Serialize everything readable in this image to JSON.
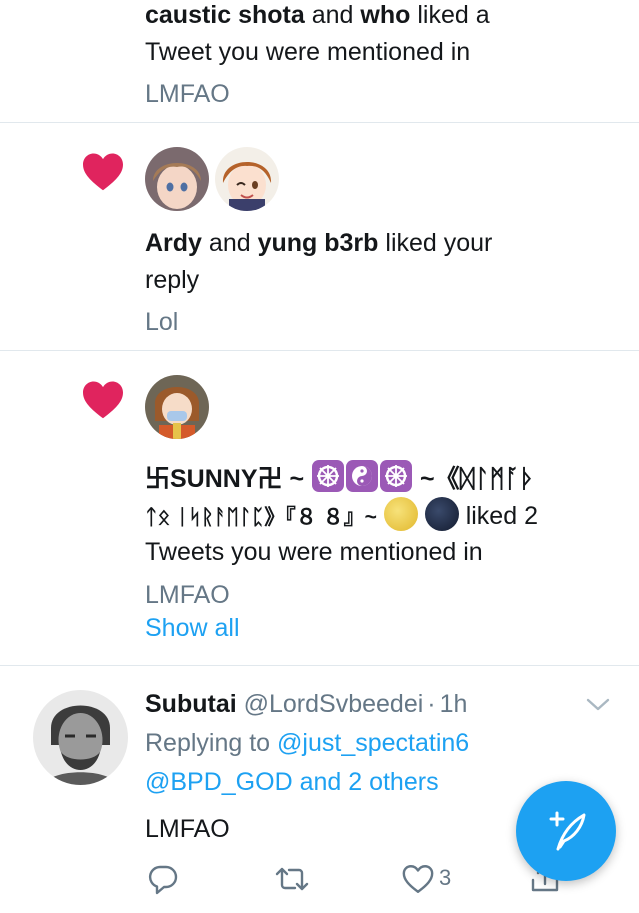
{
  "notif1": {
    "user1": "caustic shota",
    "conj": "and",
    "user2": "who",
    "action_l1": "liked a",
    "action_l2": "Tweet you were mentioned in",
    "snippet": "LMFAO"
  },
  "notif2": {
    "user1": "Ardy",
    "conj": "and",
    "user2": "yung b3rb",
    "action_l1": "liked your",
    "action_l2": "reply",
    "snippet": "Lol"
  },
  "notif3": {
    "name_part1": "卐SUNNY卍 ~",
    "name_part2": "~《ᛞᛚᛗᚪᚦ",
    "name_part3": "ᛏᛟ ᛁᛋᚱᚨᛖᛚᛈ》『８ ８』~",
    "action_l1": "liked 2",
    "action_l2": "Tweets you were mentioned in",
    "snippet": "LMFAO",
    "show_all": "Show all"
  },
  "tweet": {
    "name": "Subutai",
    "handle": "@LordSvbeedei",
    "dot": "·",
    "time": "1h",
    "replying_prefix": "Replying to",
    "mention1": "@just_spectatin6",
    "mention2": "@BPD_GOD and 2 others",
    "body": "LMFAO",
    "like_count": "3"
  },
  "colors": {
    "accent": "#1da1f2",
    "like_red": "#e0245e",
    "secondary_text": "#657786",
    "divider": "#e1e8ed"
  },
  "icons": [
    "heart-icon",
    "reply-icon",
    "retweet-icon",
    "like-outline-icon",
    "share-icon",
    "chevron-down-icon",
    "compose-tweet-icon"
  ]
}
